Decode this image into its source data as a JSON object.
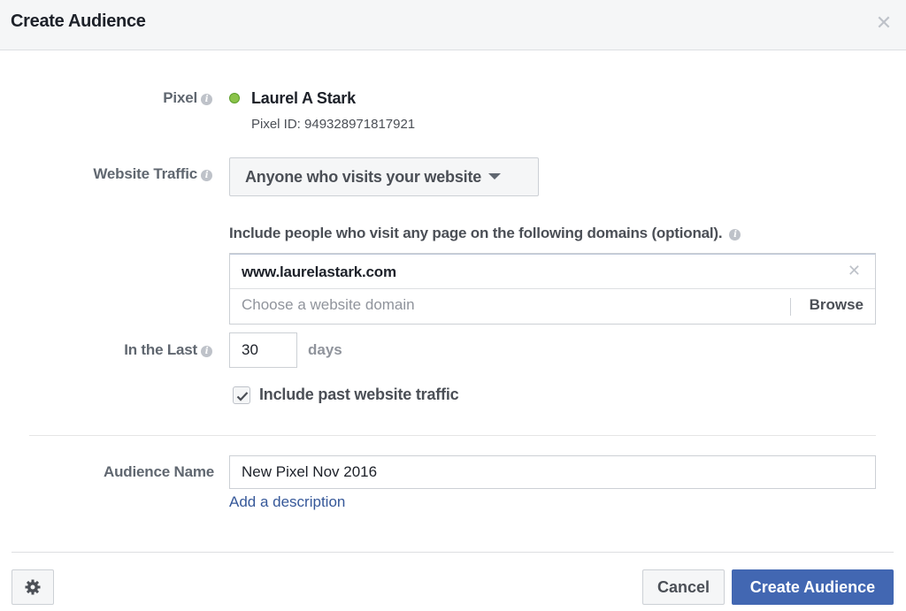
{
  "dialog": {
    "title": "Create Audience",
    "close_icon": "close-icon"
  },
  "pixel": {
    "label": "Pixel",
    "name": "Laurel A Stark",
    "id_text": "Pixel ID: 949328971817921",
    "status_color": "#8bc34a"
  },
  "website_traffic": {
    "label": "Website Traffic",
    "selected": "Anyone who visits your website"
  },
  "domains": {
    "label": "Include people who visit any page on the following domains (optional).",
    "tokens": [
      "www.laurelastark.com"
    ],
    "placeholder": "Choose a website domain",
    "browse_label": "Browse"
  },
  "in_the_last": {
    "label": "In the Last",
    "value": "30",
    "unit": "days"
  },
  "past_traffic": {
    "label": "Include past website traffic",
    "checked": true
  },
  "audience_name": {
    "label": "Audience Name",
    "value": "New Pixel Nov 2016",
    "add_description": "Add a description"
  },
  "footer": {
    "settings_icon": "gear-icon",
    "cancel_label": "Cancel",
    "create_label": "Create Audience",
    "primary_color": "#4267b2"
  }
}
